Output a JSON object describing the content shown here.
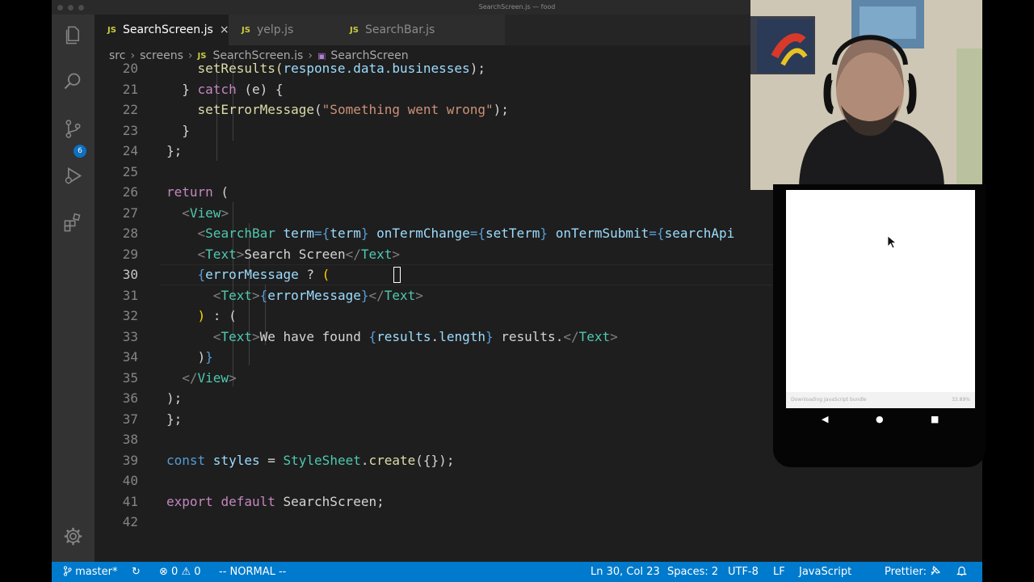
{
  "window": {
    "title": "SearchScreen.js — food"
  },
  "activity_bar": {
    "scm_badge": "6"
  },
  "tabs": [
    {
      "label": "SearchScreen.js",
      "lang": "JS",
      "active": true,
      "close": "×"
    },
    {
      "label": "yelp.js",
      "lang": "JS"
    },
    {
      "label": "SearchBar.js",
      "lang": "JS"
    }
  ],
  "breadcrumb": {
    "parts": [
      "src",
      "screens",
      "SearchScreen.js",
      "SearchScreen"
    ],
    "sep": "›",
    "lang": "JS"
  },
  "editor": {
    "line_numbers": [
      "20",
      "21",
      "22",
      "23",
      "24",
      "25",
      "26",
      "27",
      "28",
      "29",
      "30",
      "31",
      "32",
      "33",
      "34",
      "35",
      "36",
      "37",
      "38",
      "39",
      "40",
      "41",
      "42"
    ],
    "current_line": "30",
    "lines": [
      [
        [
          "    setResults(",
          "f"
        ],
        [
          "response.data.businesses",
          "v"
        ],
        [
          ");",
          "n"
        ]
      ],
      [
        [
          "  } ",
          "n"
        ],
        [
          "catch",
          "k"
        ],
        [
          " (e) {",
          "n"
        ]
      ],
      [
        [
          "    ",
          "n"
        ],
        [
          "setErrorMessage",
          "f"
        ],
        [
          "(",
          "n"
        ],
        [
          "\"Something went wrong\"",
          "s"
        ],
        [
          ");",
          "n"
        ]
      ],
      [
        [
          "  }",
          "n"
        ]
      ],
      [
        [
          "};",
          "n"
        ]
      ],
      [
        [
          "",
          "n"
        ]
      ],
      [
        [
          "return",
          "k"
        ],
        [
          " (",
          "n"
        ]
      ],
      [
        [
          "  ",
          "n"
        ],
        [
          "<",
          "p"
        ],
        [
          "View",
          "t"
        ],
        [
          ">",
          "p"
        ]
      ],
      [
        [
          "    ",
          "n"
        ],
        [
          "<",
          "p"
        ],
        [
          "SearchBar",
          "t"
        ],
        [
          " term",
          "v"
        ],
        [
          "={",
          "c"
        ],
        [
          "term",
          "v"
        ],
        [
          "}",
          "c"
        ],
        [
          " onTermChange",
          "v"
        ],
        [
          "={",
          "c"
        ],
        [
          "setTerm",
          "v"
        ],
        [
          "}",
          "c"
        ],
        [
          " onTermSubmit",
          "v"
        ],
        [
          "={",
          "c"
        ],
        [
          "searchApi",
          "v"
        ]
      ],
      [
        [
          "    ",
          "n"
        ],
        [
          "<",
          "p"
        ],
        [
          "Text",
          "t"
        ],
        [
          ">",
          "p"
        ],
        [
          "Search Screen",
          "n"
        ],
        [
          "</",
          "p"
        ],
        [
          "Text",
          "t"
        ],
        [
          ">",
          "p"
        ]
      ],
      [
        [
          "    ",
          "n"
        ],
        [
          "{",
          "c"
        ],
        [
          "errorMessage",
          "v"
        ],
        [
          " ? ",
          "n"
        ],
        [
          "(",
          "y"
        ]
      ],
      [
        [
          "      ",
          "n"
        ],
        [
          "<",
          "p"
        ],
        [
          "Text",
          "t"
        ],
        [
          ">",
          "p"
        ],
        [
          "{",
          "c"
        ],
        [
          "errorMessage",
          "v"
        ],
        [
          "}",
          "c"
        ],
        [
          "</",
          "p"
        ],
        [
          "Text",
          "t"
        ],
        [
          ">",
          "p"
        ]
      ],
      [
        [
          "    ",
          "n"
        ],
        [
          ")",
          "y"
        ],
        [
          " : (",
          "n"
        ]
      ],
      [
        [
          "      ",
          "n"
        ],
        [
          "<",
          "p"
        ],
        [
          "Text",
          "t"
        ],
        [
          ">",
          "p"
        ],
        [
          "We have found ",
          "n"
        ],
        [
          "{",
          "c"
        ],
        [
          "results",
          "v"
        ],
        [
          ".",
          "n"
        ],
        [
          "length",
          "v"
        ],
        [
          "}",
          "c"
        ],
        [
          " results.",
          "n"
        ],
        [
          "</",
          "p"
        ],
        [
          "Text",
          "t"
        ],
        [
          ">",
          "p"
        ]
      ],
      [
        [
          "    )",
          "n"
        ],
        [
          "}",
          "c"
        ]
      ],
      [
        [
          "  ",
          "n"
        ],
        [
          "</",
          "p"
        ],
        [
          "View",
          "t"
        ],
        [
          ">",
          "p"
        ]
      ],
      [
        [
          ");",
          "n"
        ]
      ],
      [
        [
          "};",
          "n"
        ]
      ],
      [
        [
          "",
          "n"
        ]
      ],
      [
        [
          "const",
          "c"
        ],
        [
          " styles",
          "v"
        ],
        [
          " = ",
          "n"
        ],
        [
          "StyleSheet",
          "t"
        ],
        [
          ".",
          "n"
        ],
        [
          "create",
          "f"
        ],
        [
          "({});",
          "n"
        ]
      ],
      [
        [
          "",
          "n"
        ]
      ],
      [
        [
          "export",
          "k"
        ],
        [
          " ",
          "n"
        ],
        [
          "default",
          "k"
        ],
        [
          " SearchScreen;",
          "n"
        ]
      ],
      [
        [
          "",
          "n"
        ]
      ]
    ]
  },
  "statusbar": {
    "branch": "master*",
    "sync": "↻",
    "errors": "0",
    "warnings": "0",
    "mode": "-- NORMAL --",
    "position": "Ln 30, Col 23",
    "spaces": "Spaces: 2",
    "encoding": "UTF-8",
    "eol": "LF",
    "language": "JavaScript",
    "prettier": "Prettier: ✓"
  },
  "phone": {
    "status": "Downloading JavaScript bundle",
    "percent": "33.89%",
    "nav": [
      "◀",
      "●",
      "■"
    ]
  }
}
